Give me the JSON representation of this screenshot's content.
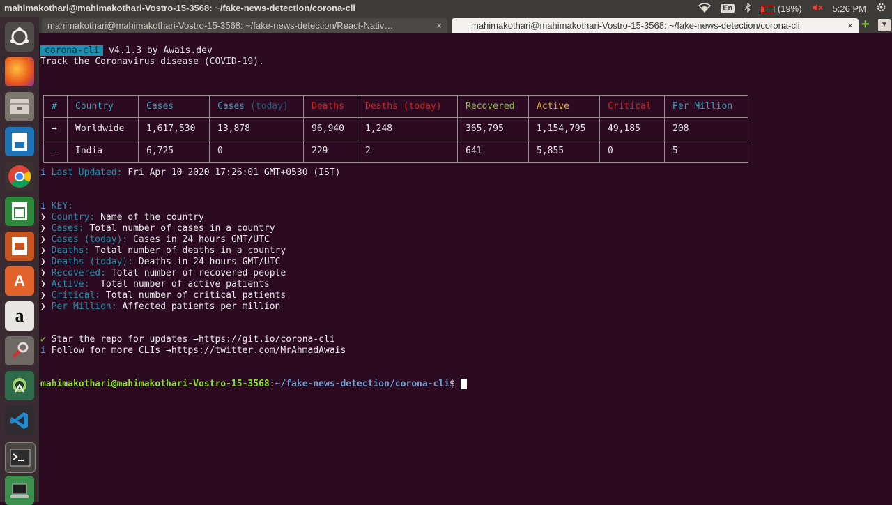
{
  "topbar": {
    "window_title": "mahimakothari@mahimakothari-Vostro-15-3568: ~/fake-news-detection/corona-cli",
    "keyboard": "En",
    "battery": "(19%)",
    "time": "5:26 PM"
  },
  "launcher": {
    "items": [
      "ubuntu-dash-icon",
      "firefox-icon",
      "files-icon",
      "writer-icon",
      "chrome-icon",
      "calc-icon",
      "impress-icon",
      "software-center-icon",
      "amazon-icon",
      "settings-icon",
      "android-studio-icon",
      "vscode-icon",
      "terminal-icon",
      "trash-icon"
    ]
  },
  "tabs": [
    {
      "label": "mahimakothari@mahimakothari-Vostro-15-3568: ~/fake-news-detection/React-Nativ…",
      "close": "×"
    },
    {
      "label": "mahimakothari@mahimakothari-Vostro-15-3568: ~/fake-news-detection/corona-cli",
      "close": "×"
    }
  ],
  "tab_plus": "+",
  "tab_menu": "▼",
  "terminal": {
    "tool_name": "corona-cli",
    "version_line": " v4.1.3 by Awais.dev",
    "subtitle": "Track the Coronavirus disease (COVID-19).",
    "table": {
      "headers": {
        "hash": "#",
        "country": "Country",
        "cases": "Cases",
        "cases_today_a": "Cases",
        "cases_today_b": " (today)",
        "deaths": "Deaths",
        "deaths_today": "Deaths (today)",
        "recovered": "Recovered",
        "active": "Active",
        "critical": "Critical",
        "per_million": "Per Million"
      },
      "rows": [
        {
          "marker": "→",
          "country": "Worldwide",
          "cases": "1,617,530",
          "cases_today": "13,878",
          "deaths": "96,940",
          "deaths_today": "1,248",
          "recovered": "365,795",
          "active": "1,154,795",
          "critical": "49,185",
          "per_million": "208"
        },
        {
          "marker": "–",
          "country": "India",
          "cases": "6,725",
          "cases_today": "0",
          "deaths": "229",
          "deaths_today": "2",
          "recovered": "641",
          "active": "5,855",
          "critical": "0",
          "per_million": "5"
        }
      ]
    },
    "info_icon": "i",
    "last_updated_label": " Last Updated: ",
    "last_updated_value": "Fri Apr 10 2020 17:26:01 GMT+0530 (IST)",
    "key_label": " KEY:",
    "bullet": "❯",
    "key_items": [
      {
        "term": " Country:",
        "desc": " Name of the country"
      },
      {
        "term": " Cases:",
        "desc": " Total number of cases in a country"
      },
      {
        "term": " Cases (today):",
        "desc": " Cases in 24 hours GMT/UTC"
      },
      {
        "term": " Deaths:",
        "desc": " Total number of deaths in a country"
      },
      {
        "term": " Deaths (today):",
        "desc": " Deaths in 24 hours GMT/UTC"
      },
      {
        "term": " Recovered:",
        "desc": " Total number of recovered people"
      },
      {
        "term": " Active:",
        "desc": "  Total number of active patients"
      },
      {
        "term": " Critical:",
        "desc": " Total number of critical patients"
      },
      {
        "term": " Per Million:",
        "desc": " Affected patients per million"
      }
    ],
    "check_icon": "✔",
    "star_text": " Star the repo for updates →",
    "star_url": "https://git.io/corona-cli",
    "follow_text": " Follow for more CLIs →",
    "follow_url": "https://twitter.com/MrAhmadAwais",
    "prompt_user": "mahimakothari@mahimakothari-Vostro-15-3568",
    "prompt_sep": ":",
    "prompt_path": "~/fake-news-detection/corona-cli",
    "prompt_dollar": "$ "
  }
}
